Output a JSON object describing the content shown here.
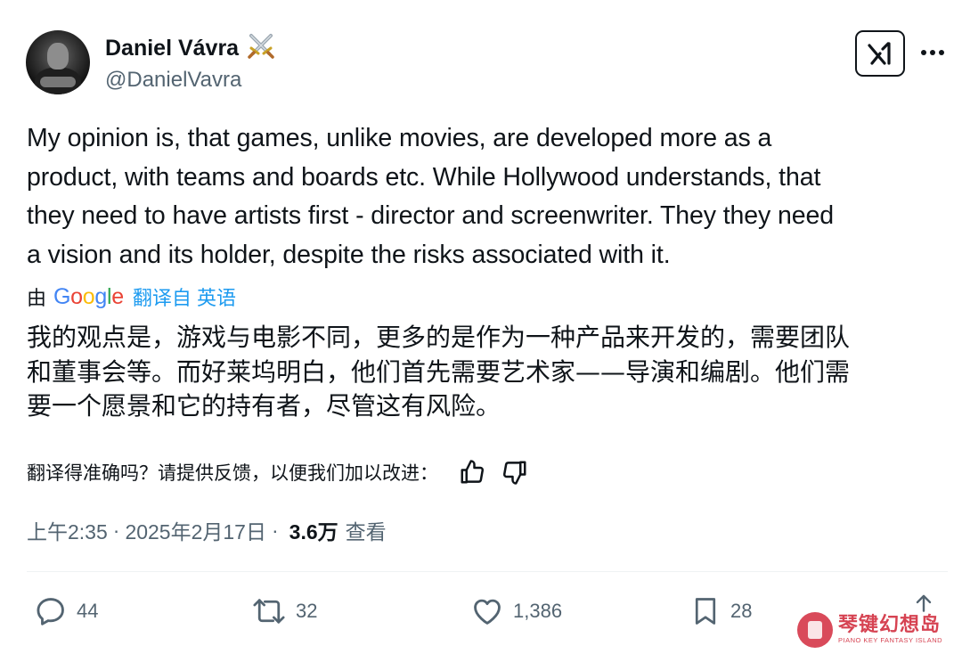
{
  "author": {
    "name": "Daniel Vávra",
    "name_emoji": "crossed-swords",
    "handle": "@DanielVavra",
    "avatar": "user-avatar-photo"
  },
  "header_actions": {
    "grok_icon": "grok-icon",
    "more_icon": "more-dots-icon"
  },
  "tweet": {
    "lines": [
      "My opinion is, that games, unlike movies, are developed more as a",
      "product, with teams and boards etc. While Hollywood understands, that",
      "they need to have artists first - director and screenwriter. They they need",
      "a vision and its holder, despite the risks associated with it."
    ]
  },
  "translation_bar": {
    "by": "由",
    "provider": "Google",
    "label": "翻译自 英语"
  },
  "translation": {
    "lines": [
      "我的观点是，游戏与电影不同，更多的是作为一种产品来开发的，需要团队",
      "和董事会等。而好莱坞明白，他们首先需要艺术家——导演和编剧。他们需",
      "要一个愿景和它的持有者，尽管这有风险。"
    ]
  },
  "feedback": {
    "prompt": "翻译得准确吗？请提供反馈，以便我们加以改进：",
    "thumbs_up_icon": "thumbs-up-icon",
    "thumbs_down_icon": "thumbs-down-icon"
  },
  "meta": {
    "time": "上午2:35",
    "date": "2025年2月17日",
    "separator": "·",
    "views_count": "3.6万",
    "views_label": "查看"
  },
  "actions": {
    "replies": "44",
    "reposts": "32",
    "likes": "1,386",
    "bookmarks": "28"
  },
  "watermark": {
    "cn": "琴键幻想岛",
    "en": "PIANO KEY FANTASY ISLAND"
  },
  "colors": {
    "text": "#0f1419",
    "secondary": "#536471",
    "link": "#1d9bf0",
    "divider": "#eff3f4"
  }
}
